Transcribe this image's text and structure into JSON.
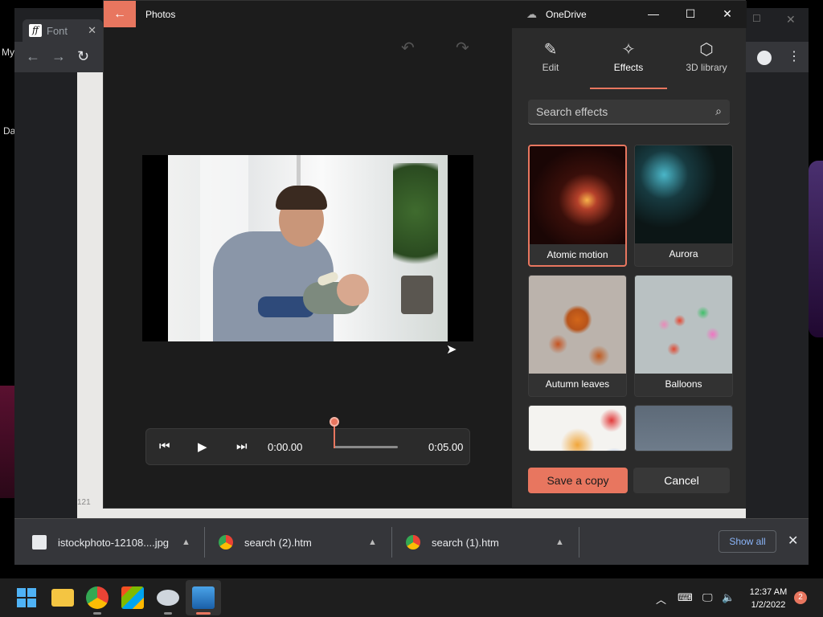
{
  "browser": {
    "tab_title": "Font",
    "tab_icon": "font-favicon",
    "desktop_snippet_1": "My",
    "desktop_snippet_2": "Da",
    "page_snippet": "121"
  },
  "photos": {
    "app_title": "Photos",
    "onedrive_label": "OneDrive",
    "accent": "#e8765f",
    "tabs": [
      {
        "label": "Edit",
        "icon": "pencil-icon"
      },
      {
        "label": "Effects",
        "icon": "sparkle-icon",
        "active": true
      },
      {
        "label": "3D library",
        "icon": "cube-icon"
      }
    ],
    "search_placeholder": "Search effects",
    "effects": [
      {
        "label": "Atomic motion",
        "selected": true
      },
      {
        "label": "Aurora"
      },
      {
        "label": "Autumn leaves"
      },
      {
        "label": "Balloons"
      }
    ],
    "save_label": "Save a copy",
    "cancel_label": "Cancel",
    "playback": {
      "current_time": "0:00.00",
      "end_time": "0:05.00",
      "progress": 0
    }
  },
  "downloads": {
    "items": [
      {
        "name": "istockphoto-12108....jpg",
        "icon": "image-file-icon"
      },
      {
        "name": "search (2).htm",
        "icon": "chrome-icon"
      },
      {
        "name": "search (1).htm",
        "icon": "chrome-icon"
      }
    ],
    "show_all_label": "Show all"
  },
  "taskbar": {
    "time": "12:37 AM",
    "date": "1/2/2022",
    "notification_count": "2",
    "apps": [
      "windows-start-icon",
      "file-explorer-icon",
      "chrome-icon",
      "store-icon",
      "xbox-icon",
      "photos-icon"
    ]
  }
}
